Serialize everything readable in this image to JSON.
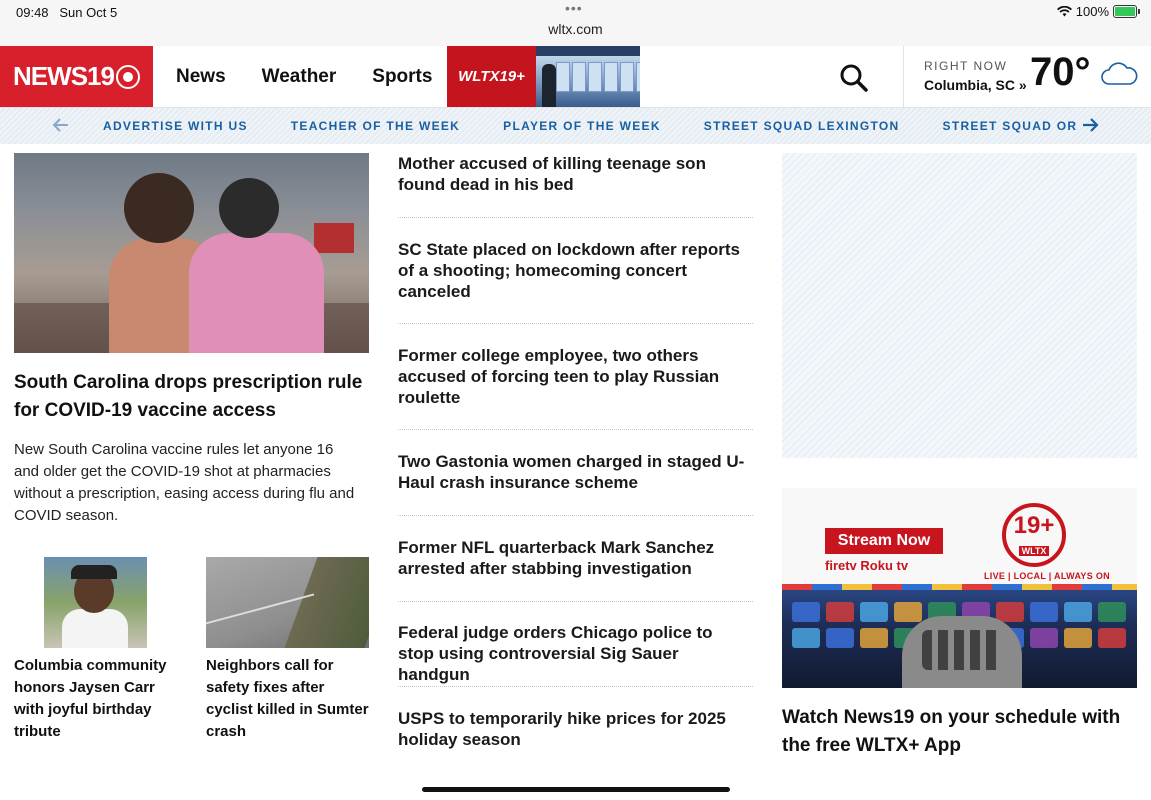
{
  "status_bar": {
    "time": "09:48",
    "date": "Sun Oct 5",
    "url": "wltx.com",
    "battery": "100%"
  },
  "header": {
    "logo_text": "NEWS19",
    "nav": [
      "News",
      "Weather",
      "Sports"
    ],
    "wltx_badge": "WLTX19+",
    "right_now_label": "RIGHT NOW",
    "location": "Columbia, SC »",
    "temperature": "70°",
    "icons": {
      "search": "search-icon",
      "weather": "cloud-icon"
    }
  },
  "subnav": {
    "items": [
      "ADVERTISE WITH US",
      "TEACHER OF THE WEEK",
      "PLAYER OF THE WEEK",
      "STREET SQUAD LEXINGTON",
      "STREET SQUAD ORANGEBU"
    ]
  },
  "featured": {
    "title": "South Carolina drops prescription rule for COVID-19 vaccine access",
    "description": "New South Carolina vaccine rules let anyone 16 and older get the COVID-19 shot at pharmacies without a prescription, easing access during flu and COVID season."
  },
  "small_stories": [
    {
      "title": "Columbia community honors Jaysen Carr with joyful birthday tribute"
    },
    {
      "title": "Neighbors call for safety fixes after cyclist killed in Sumter crash"
    }
  ],
  "headlines": [
    "Mother accused of killing teenage son found dead in his bed",
    "SC State placed on lockdown after reports of a shooting; homecoming concert canceled",
    "Former college employee, two others accused of forcing teen to play Russian roulette",
    "Two Gastonia women charged in staged U-Haul crash insurance scheme",
    "Former NFL quarterback Mark Sanchez arrested after stabbing investigation",
    "Federal judge orders Chicago police to stop using controversial Sig Sauer handgun",
    "USPS to temporarily hike prices for 2025 holiday season"
  ],
  "promo": {
    "stream_now": "Stream Now",
    "platforms": "firetv  Roku  tv",
    "badge_num": "19+",
    "badge_sub": "WLTX",
    "tagline": "LIVE | LOCAL | ALWAYS ON",
    "title": "Watch News19 on your schedule with the free WLTX+ App"
  },
  "colors": {
    "brand_red": "#d7202c",
    "link_blue": "#1a5fa0"
  }
}
